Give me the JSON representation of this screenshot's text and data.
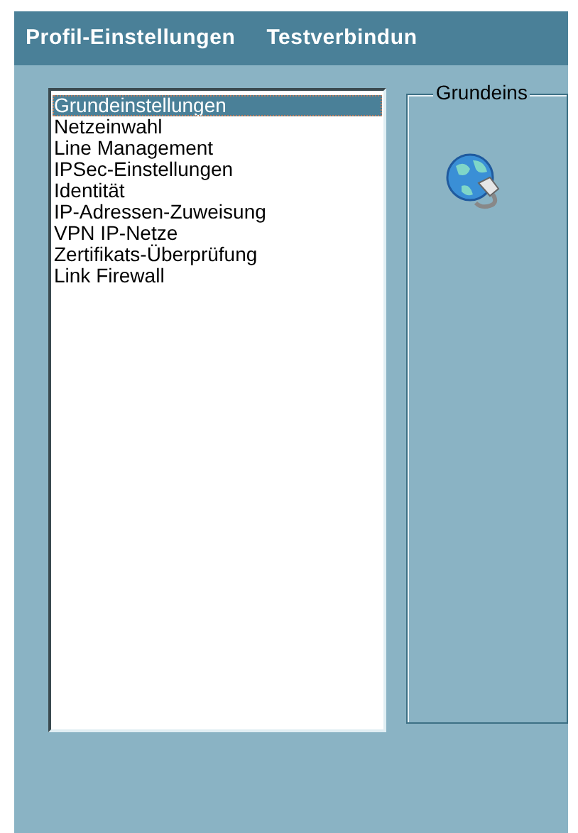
{
  "tabs": [
    {
      "label": "Profil-Einstellungen"
    },
    {
      "label": "Testverbindun"
    }
  ],
  "categories": [
    {
      "label": "Grundeinstellungen",
      "selected": true
    },
    {
      "label": "Netzeinwahl",
      "selected": false
    },
    {
      "label": "Line Management",
      "selected": false
    },
    {
      "label": "IPSec-Einstellungen",
      "selected": false
    },
    {
      "label": "Identität",
      "selected": false
    },
    {
      "label": "IP-Adressen-Zuweisung",
      "selected": false
    },
    {
      "label": "VPN IP-Netze",
      "selected": false
    },
    {
      "label": "Zertifikats-Überprüfung",
      "selected": false
    },
    {
      "label": "Link Firewall",
      "selected": false
    }
  ],
  "group": {
    "title": "Grundeins"
  }
}
